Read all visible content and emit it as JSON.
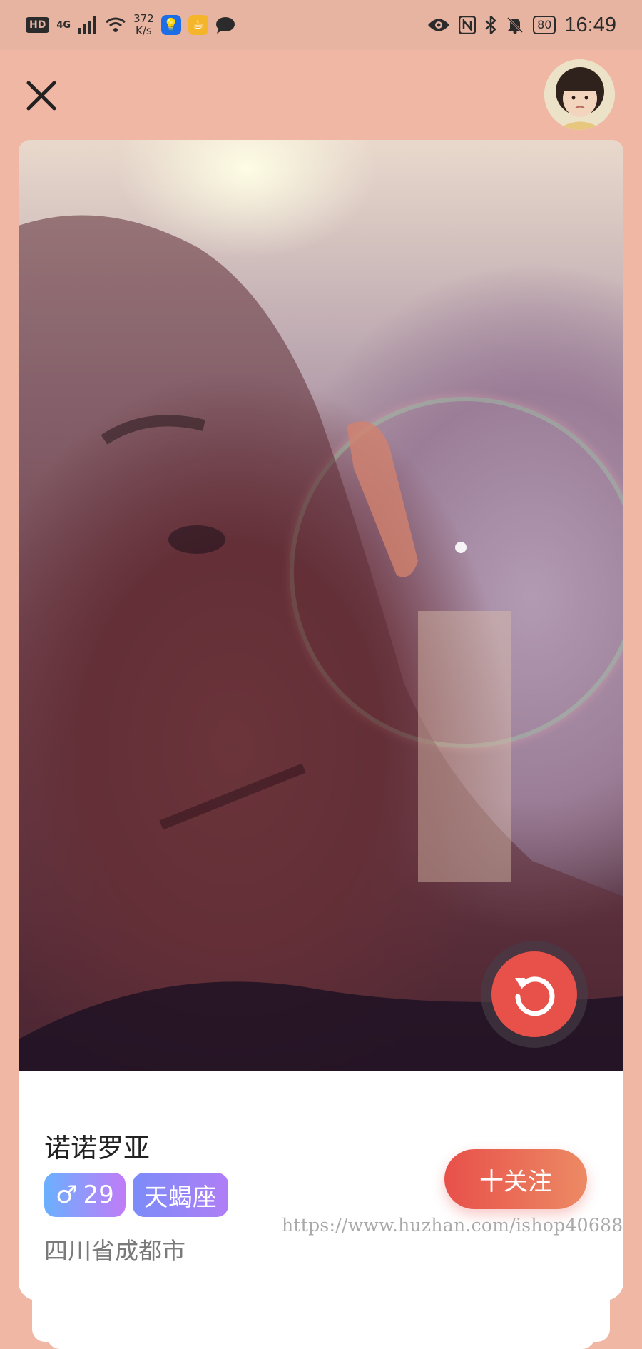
{
  "status_bar": {
    "hd": "HD",
    "network": "4G",
    "speed_value": "372",
    "speed_unit": "K/s",
    "battery": "80",
    "time": "16:49",
    "icons": [
      "signal-icon",
      "wifi-icon",
      "bulb-app-icon",
      "cup-app-icon",
      "chat-icon",
      "eye-icon",
      "nfc-icon",
      "bluetooth-icon",
      "bell-muted-icon",
      "battery-icon"
    ]
  },
  "header": {
    "close_icon": "close-icon",
    "avatar": "user-avatar"
  },
  "photo": {
    "replay_icon": "replay-icon"
  },
  "profile": {
    "name": "诺诺罗亚",
    "gender_symbol": "♂",
    "age": "29",
    "zodiac": "天蝎座",
    "location": "四川省成都市",
    "follow_label": "十关注"
  },
  "watermark": "https://www.huzhan.com/ishop40688",
  "colors": {
    "background": "#f0b8a4",
    "accent": "#e8504a",
    "tag_gradient_start": "#6ab0ff",
    "tag_gradient_end": "#c07cf7"
  }
}
